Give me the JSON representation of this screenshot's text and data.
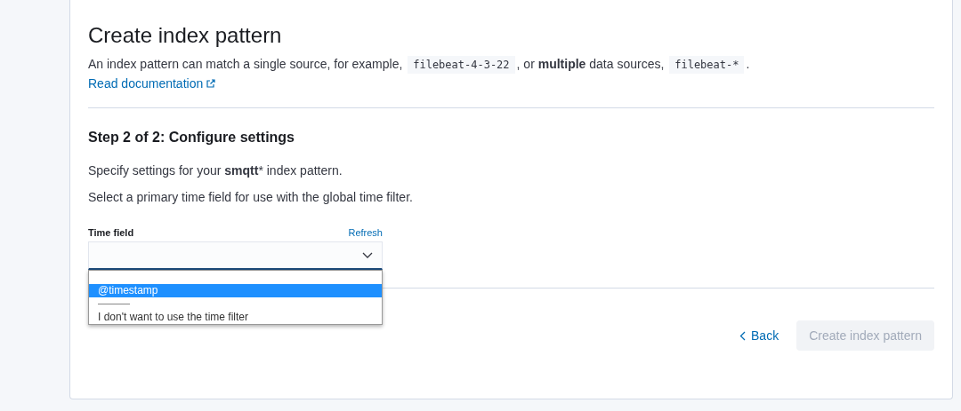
{
  "header": {
    "title": "Create index pattern",
    "description": "An index pattern can match a single source, for example, ",
    "example_single": "filebeat-4-3-22",
    "description_middle": ", or **multiple** data sources, ",
    "example_multiple": "filebeat-*",
    "description_end": ".",
    "doc_link": "Read documentation"
  },
  "step": {
    "title": "Step 2 of 2: Configure settings",
    "intro": "Specify settings for your **smqtt*** index pattern.",
    "hint": "Select a primary time field for use with the global time filter."
  },
  "time_field": {
    "label": "Time field",
    "refresh": "Refresh",
    "expanded": true,
    "options": [
      {
        "kind": "blank",
        "selected": false
      },
      {
        "kind": "option",
        "label": "@timestamp",
        "selected": true
      },
      {
        "kind": "separator",
        "label": "———",
        "selected": false
      },
      {
        "kind": "option",
        "label": "I don't want to use the time filter",
        "selected": false
      }
    ]
  },
  "footer": {
    "back": "Back",
    "create": "Create index pattern",
    "create_disabled": true
  }
}
